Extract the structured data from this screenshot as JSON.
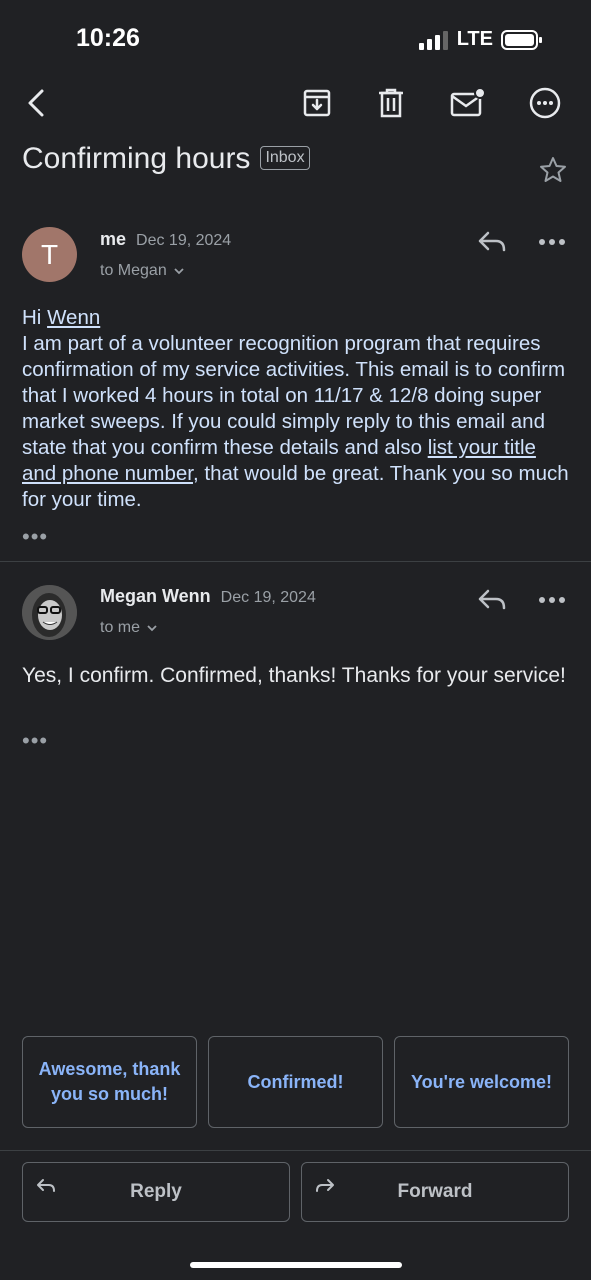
{
  "status_bar": {
    "time": "10:26",
    "network": "LTE"
  },
  "email": {
    "subject": "Confirming hours",
    "label": "Inbox"
  },
  "messages": [
    {
      "avatar_letter": "T",
      "sender": "me",
      "date": "Dec 19, 2024",
      "recipient": "to Megan",
      "body": {
        "greeting": "Hi ",
        "greeting_name": "Wenn",
        "text": "I am part of a volunteer recognition program that requires confirmation of my service activities. This email is to confirm that I worked 4 hours in total on 11/17 & 12/8 doing super market sweeps. If you could simply reply to this email and state that you confirm these details and also ",
        "link": "list your title and phone number",
        "text_end": ", that would be great. Thank you so much for your time."
      },
      "more": "•••"
    },
    {
      "sender": "Megan Wenn",
      "date": "Dec 19, 2024",
      "recipient": "to me",
      "body": "Yes, I confirm. Confirmed, thanks! Thanks for your service!",
      "more": "•••"
    }
  ],
  "smart_replies": [
    "Awesome, thank you so much!",
    "Confirmed!",
    "You're welcome!"
  ],
  "actions": {
    "reply": "Reply",
    "forward": "Forward"
  },
  "colors": {
    "background": "#202124",
    "link": "#8ab4f8",
    "avatar": "#a1766a"
  }
}
